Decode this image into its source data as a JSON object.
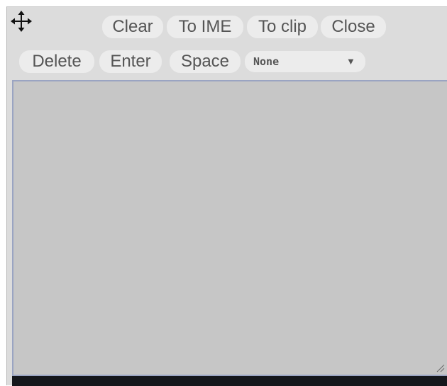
{
  "toolbar": {
    "move_icon": "four-way-arrow-move",
    "buttons": {
      "clear": "Clear",
      "to_ime": "To IME",
      "to_clip": "To clip",
      "close": "Close",
      "delete": "Delete",
      "enter": "Enter",
      "space": "Space"
    },
    "select": {
      "value": "None",
      "arrow": "▼"
    }
  },
  "textarea": {
    "value": ""
  }
}
